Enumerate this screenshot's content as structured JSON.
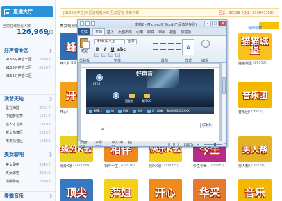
{
  "sidebar": {
    "lobby_label": "直播大厅",
    "online_label": "当前在线观看人数",
    "online_count": "126,969",
    "online_unit": "位",
    "sections": [
      {
        "title": "好声音专区",
        "rooms": [
          {
            "name": "9158好声音一区",
            "count": "7926人"
          },
          {
            "name": "9158好声音二区",
            "count": "6150人"
          },
          {
            "name": "9158好声音三区",
            "count": ""
          }
        ]
      },
      {
        "title": "演艺天地",
        "rooms": [
          {
            "name": "星光海陆",
            "count": "3801人"
          },
          {
            "name": "中国梦想秀",
            "count": "1691人"
          },
          {
            "name": "佳人才艺秀",
            "count": "1919人"
          },
          {
            "name": "靓女热舞区",
            "count": "2093人"
          },
          {
            "name": "唯美情音区",
            "count": "1686人"
          }
        ]
      },
      {
        "title": "美女聊吧",
        "rooms": [
          {
            "name": "美女聊吧",
            "count": "3845人"
          },
          {
            "name": "美女聊吧",
            "count": "3904人"
          },
          {
            "name": "情缘聊吧",
            "count": "2926人"
          }
        ]
      },
      {
        "title": "麦霸音乐",
        "rooms": []
      }
    ]
  },
  "notice": {
    "text": "[9158好声音]三区演唱者80K 互动留言 精彩不断",
    "hot": "区长：90599（QQ：915843399）"
  },
  "tabs_label": "美女视频聊",
  "favorites_label": "我的收藏",
  "cards": [
    {
      "name": "蜂巢",
      "cap_name": "蜂~巢",
      "num": "(19",
      "bg": "#2e6fb5",
      "text": "蜂巢"
    },
    {
      "name": "猫猫城堡",
      "cap_name": "猫猫城堡",
      "num": "(19052)",
      "bg": "#f9c11d",
      "text": "猫猫城堡"
    },
    {
      "name": "开会",
      "cap_name": "开心",
      "num": "(",
      "bg": "#f2a11c",
      "text": "开会"
    },
    {
      "name": "音乐团",
      "cap_name": "音乐团",
      "num": "(19925)",
      "bg": "#f5b800",
      "text": "音乐团"
    },
    {
      "name": "缘分K歌",
      "cap_name": "缘分K歌",
      "num": "(140088)",
      "bg": "#e8d020",
      "text": "缘分K歌"
    },
    {
      "name": "相伴",
      "cap_name": "相伴一生",
      "num": "(200518)",
      "bg": "#f08a1a",
      "text": "相伴"
    },
    {
      "name": "快乐K歌",
      "cap_name": "快乐K歌",
      "num": "(190065)",
      "bg": "#f5d018",
      "text": "快乐K歌"
    },
    {
      "name": "今生",
      "cap_name": "今生今世",
      "num": "(188095)",
      "bg": "#b92b8a",
      "text": "今生"
    },
    {
      "name": "男人帮",
      "cap_name": "男人帮",
      "num": "(136788)",
      "bg": "#e4b222",
      "text": "男人帮"
    },
    {
      "name": "顶尖",
      "cap_name": "",
      "num": "",
      "bg": "#3778c0",
      "text": "顶尖"
    },
    {
      "name": "萍姐",
      "cap_name": "",
      "num": "",
      "bg": "#f5d018",
      "text": "萍姐"
    },
    {
      "name": "开心",
      "cap_name": "",
      "num": "",
      "bg": "#f08a1a",
      "text": "开心"
    },
    {
      "name": "华采",
      "cap_name": "",
      "num": "",
      "bg": "#e47b2c",
      "text": "华采"
    },
    {
      "name": "音乐",
      "cap_name": "",
      "num": "",
      "bg": "#f5b800",
      "text": "音乐"
    }
  ],
  "word": {
    "title": "文档2 - Microsoft Word(产品激活失败)",
    "file_tab": "文件",
    "tabs": [
      "开始",
      "插入",
      "页面布局",
      "引用",
      "邮件",
      "审阅",
      "视图",
      "加载项"
    ],
    "paste_label": "粘贴",
    "font_name": "宋体(中文正",
    "font_size": "五号",
    "clipboard_label": "剪贴板",
    "font_group_label": "字体",
    "para_group_label": "段落",
    "style_group_label": "样式",
    "style_button_label": "A",
    "edit_group_label": "编辑",
    "status_page": "页面: 2/2",
    "status_words": "字数: 296",
    "status_lang": "中文(中国)",
    "status_insert": "插入",
    "zoom": "100%",
    "zoom_minus": "−",
    "zoom_plus": "+",
    "ctrl_badge": "(Ctrl)",
    "shot": {
      "brand": "好声音",
      "ie_icon": "e",
      "desk_labels": [
        "9158",
        "回收站",
        "腾讯QQ"
      ],
      "task_items": [
        "新建...",
        "的",
        "回收",
        "朋友",
        "Q - 邮箱",
        "聚浪XXXXXXXXX"
      ]
    }
  },
  "colors": {
    "accent": "#2a93d8",
    "count_blue": "#0b5aa5",
    "word_file_blue": "#2b5797"
  }
}
